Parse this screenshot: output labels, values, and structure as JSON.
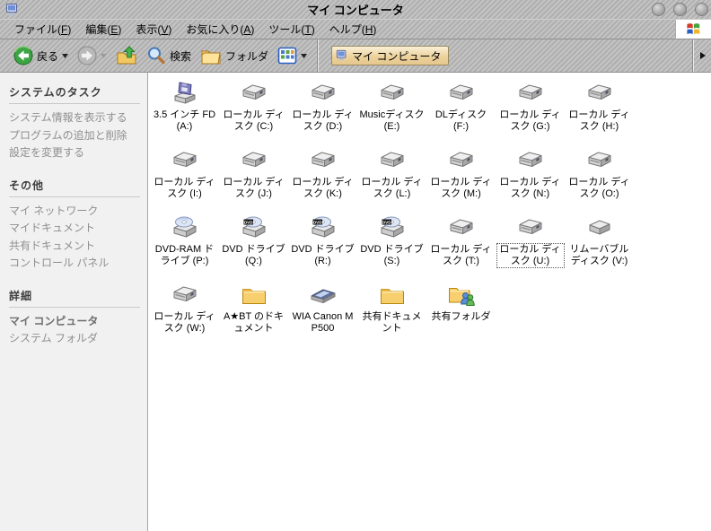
{
  "window": {
    "title": "マイ コンピュータ"
  },
  "menu": {
    "items": [
      {
        "pre": "ファイル(",
        "key": "F",
        "post": ")"
      },
      {
        "pre": "編集(",
        "key": "E",
        "post": ")"
      },
      {
        "pre": "表示(",
        "key": "V",
        "post": ")"
      },
      {
        "pre": "お気に入り(",
        "key": "A",
        "post": ")"
      },
      {
        "pre": "ツール(",
        "key": "T",
        "post": ")"
      },
      {
        "pre": "ヘルプ(",
        "key": "H",
        "post": ")"
      }
    ]
  },
  "toolbar": {
    "back_label": "戻る",
    "search_label": "検索",
    "folders_label": "フォルダ"
  },
  "address": {
    "value": "マイ コンピュータ"
  },
  "sidebar": {
    "sections": [
      {
        "title": "システムのタスク",
        "items": [
          {
            "label": "システム情報を表示する"
          },
          {
            "label": "プログラムの追加と削除"
          },
          {
            "label": "設定を変更する"
          }
        ]
      },
      {
        "title": "その他",
        "items": [
          {
            "label": "マイ ネットワーク"
          },
          {
            "label": "マイドキュメント"
          },
          {
            "label": "共有ドキュメント"
          },
          {
            "label": "コントロール パネル"
          }
        ]
      },
      {
        "title": "詳細",
        "items": [
          {
            "label": "マイ コンピュータ",
            "bold": true
          },
          {
            "label": "システム フォルダ"
          }
        ]
      }
    ]
  },
  "colors": {
    "chrome_stripe_light": "#c4c4c4",
    "chrome_stripe_dark": "#afafaf",
    "sidebar_bg": "#f1f1f1",
    "address_button_bg": "#ecd29d",
    "back_button_green": "#37a33c",
    "folder_yellow": "#f7cf6e"
  },
  "icons": [
    {
      "label": "3.5 インチ FD (A:)",
      "icon": "floppy-drive-icon"
    },
    {
      "label": "ローカル ディスク (C:)",
      "icon": "hard-disk-icon"
    },
    {
      "label": "ローカル ディスク (D:)",
      "icon": "hard-disk-icon"
    },
    {
      "label": "Musicディスク (E:)",
      "icon": "hard-disk-icon"
    },
    {
      "label": "DLディスク (F:)",
      "icon": "hard-disk-icon"
    },
    {
      "label": "ローカル ディスク (G:)",
      "icon": "hard-disk-icon"
    },
    {
      "label": "ローカル ディスク (H:)",
      "icon": "hard-disk-icon"
    },
    {
      "label": "ローカル ディスク (I:)",
      "icon": "hard-disk-icon"
    },
    {
      "label": "ローカル ディスク (J:)",
      "icon": "hard-disk-icon"
    },
    {
      "label": "ローカル ディスク (K:)",
      "icon": "hard-disk-icon"
    },
    {
      "label": "ローカル ディスク (L:)",
      "icon": "hard-disk-icon"
    },
    {
      "label": "ローカル ディスク (M:)",
      "icon": "hard-disk-icon"
    },
    {
      "label": "ローカル ディスク (N:)",
      "icon": "hard-disk-icon"
    },
    {
      "label": "ローカル ディスク (O:)",
      "icon": "hard-disk-icon"
    },
    {
      "label": "DVD-RAM ドライブ (P:)",
      "icon": "dvd-ram-drive-icon"
    },
    {
      "label": "DVD ドライブ (Q:)",
      "icon": "dvd-drive-icon"
    },
    {
      "label": "DVD ドライブ (R:)",
      "icon": "dvd-drive-icon"
    },
    {
      "label": "DVD ドライブ (S:)",
      "icon": "dvd-drive-icon"
    },
    {
      "label": "ローカル ディスク (T:)",
      "icon": "hard-disk-icon"
    },
    {
      "label": "ローカル ディスク (U:)",
      "icon": "hard-disk-icon",
      "selected": true
    },
    {
      "label": "リムーバブル ディスク (V:)",
      "icon": "removable-disk-icon"
    },
    {
      "label": "ローカル ディスク (W:)",
      "icon": "hard-disk-icon"
    },
    {
      "label": "A★BT のドキュメント",
      "icon": "folder-icon"
    },
    {
      "label": "WIA Canon MP500",
      "icon": "scanner-icon"
    },
    {
      "label": "共有ドキュメント",
      "icon": "folder-icon"
    },
    {
      "label": "共有フォルダ",
      "icon": "shared-folder-icon"
    }
  ]
}
